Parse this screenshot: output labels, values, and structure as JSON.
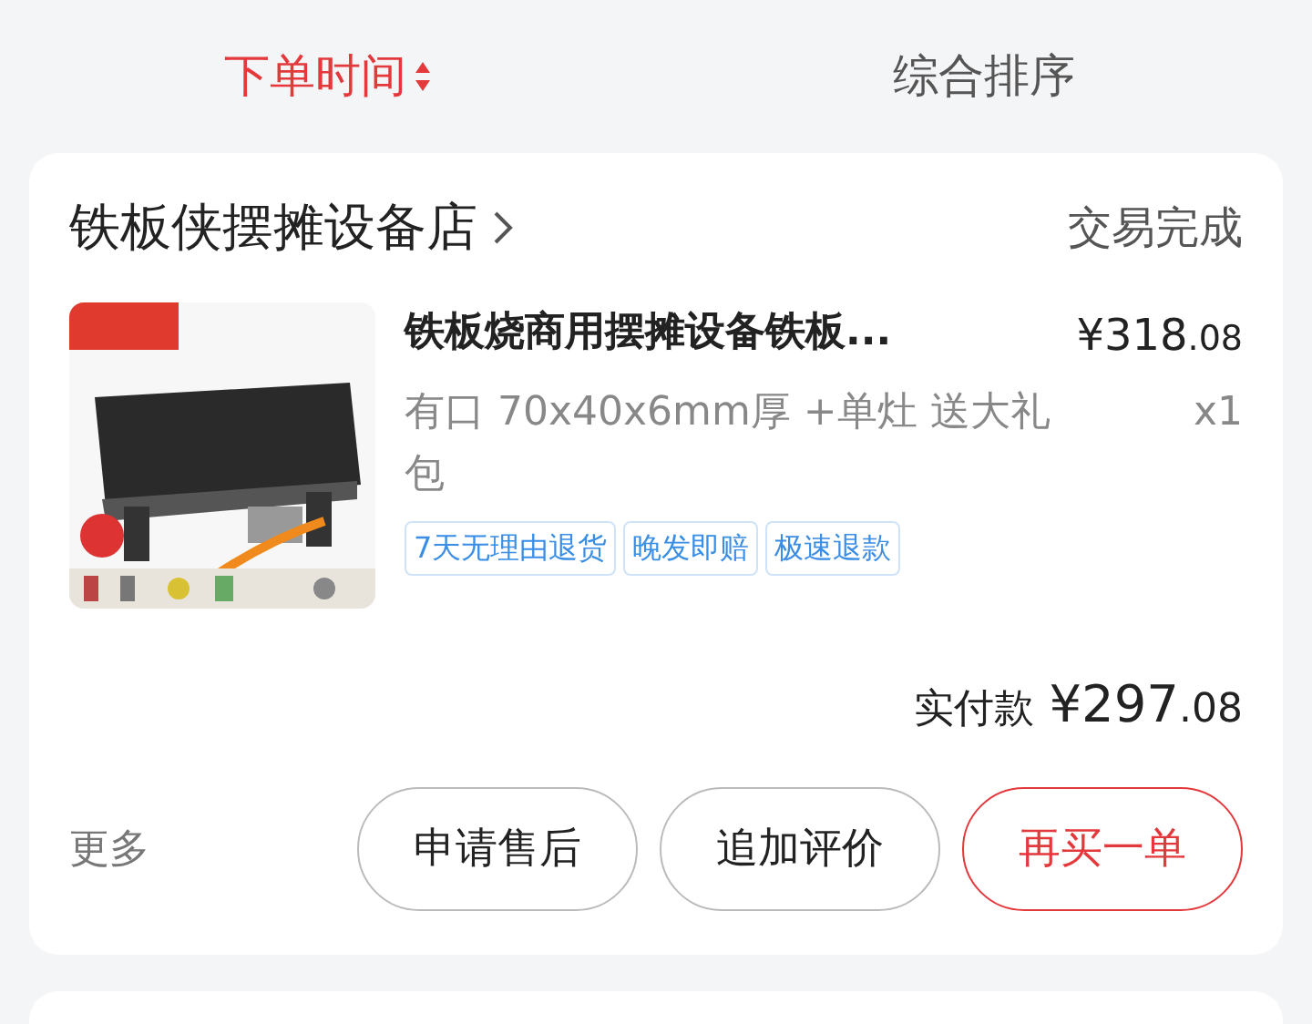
{
  "sort_tabs": [
    {
      "label": "下单时间",
      "selected": true
    },
    {
      "label": "综合排序",
      "selected": false
    }
  ],
  "order": {
    "store": "铁板侠摆摊设备店",
    "status": "交易完成",
    "product": {
      "kind": "picture",
      "title": "铁板烧商用摆摊设备铁板...",
      "price_main": "¥318",
      "price_decimal": ".08",
      "spec": "有口 70x40x6mm厚 +单灶 送大礼包",
      "quantity": "x1",
      "tags": [
        "7天无理由退货",
        "晚发即赔",
        "极速退款"
      ]
    },
    "total_label": "实付款",
    "total_main": "¥297",
    "total_decimal": ".08",
    "more": "更多",
    "actions": [
      {
        "label": "申请售后",
        "kind": "secondary"
      },
      {
        "label": "追加评价",
        "kind": "secondary"
      },
      {
        "label": "再买一单",
        "kind": "primary"
      }
    ]
  }
}
